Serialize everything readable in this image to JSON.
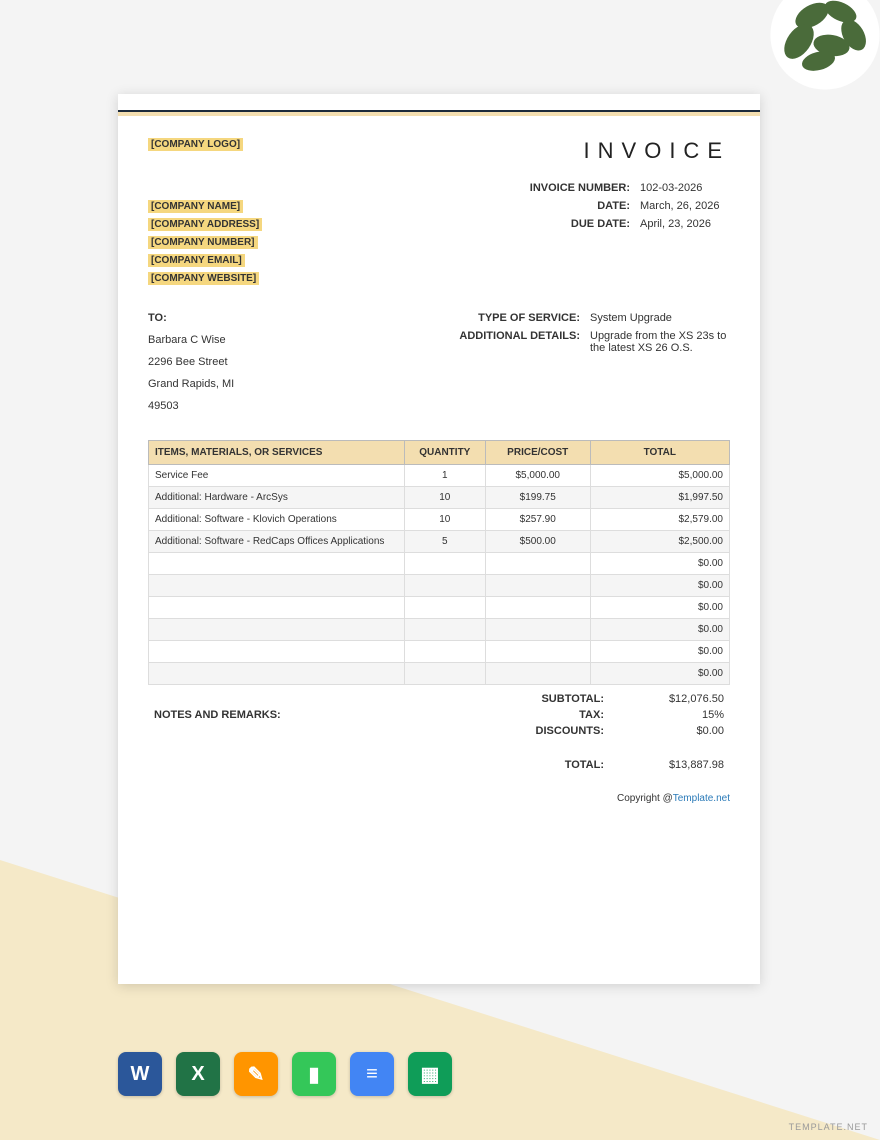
{
  "header": {
    "logo_placeholder": "[COMPANY LOGO]",
    "title": "INVOICE"
  },
  "company": {
    "name": "[COMPANY NAME]",
    "address": "[COMPANY ADDRESS]",
    "number": "[COMPANY NUMBER]",
    "email": "[COMPANY EMAIL]",
    "website": "[COMPANY WEBSITE]"
  },
  "invoice_meta": {
    "number_label": "INVOICE NUMBER:",
    "number_value": "102-03-2026",
    "date_label": "DATE:",
    "date_value": "March, 26, 2026",
    "due_label": "DUE DATE:",
    "due_value": "April, 23, 2026"
  },
  "bill_to": {
    "label": "TO:",
    "name": "Barbara C Wise",
    "street": "2296 Bee Street",
    "city": "Grand Rapids, MI",
    "zip": "49503"
  },
  "service": {
    "type_label": "TYPE OF SERVICE:",
    "type_value": "System Upgrade",
    "details_label": "ADDITIONAL DETAILS:",
    "details_value": "Upgrade from the XS 23s to the latest XS 26 O.S."
  },
  "table": {
    "headers": {
      "items": "ITEMS, MATERIALS, OR SERVICES",
      "qty": "QUANTITY",
      "price": "PRICE/COST",
      "total": "TOTAL"
    },
    "rows": [
      {
        "desc": "Service Fee",
        "qty": "1",
        "price": "$5,000.00",
        "total": "$5,000.00"
      },
      {
        "desc": "Additional: Hardware - ArcSys",
        "qty": "10",
        "price": "$199.75",
        "total": "$1,997.50"
      },
      {
        "desc": "Additional: Software - Klovich Operations",
        "qty": "10",
        "price": "$257.90",
        "total": "$2,579.00"
      },
      {
        "desc": "Additional: Software - RedCaps Offices Applications",
        "qty": "5",
        "price": "$500.00",
        "total": "$2,500.00"
      },
      {
        "desc": "",
        "qty": "",
        "price": "",
        "total": "$0.00"
      },
      {
        "desc": "",
        "qty": "",
        "price": "",
        "total": "$0.00"
      },
      {
        "desc": "",
        "qty": "",
        "price": "",
        "total": "$0.00"
      },
      {
        "desc": "",
        "qty": "",
        "price": "",
        "total": "$0.00"
      },
      {
        "desc": "",
        "qty": "",
        "price": "",
        "total": "$0.00"
      },
      {
        "desc": "",
        "qty": "",
        "price": "",
        "total": "$0.00"
      }
    ]
  },
  "summary": {
    "subtotal_label": "SUBTOTAL:",
    "subtotal_value": "$12,076.50",
    "tax_label": "TAX:",
    "tax_value": "15%",
    "discounts_label": "DISCOUNTS:",
    "discounts_value": "$0.00",
    "total_label": "TOTAL:",
    "total_value": "$13,887.98",
    "notes_label": "NOTES AND REMARKS:"
  },
  "footer": {
    "copyright": "Copyright @",
    "link": "Template.net"
  },
  "apps": [
    {
      "name": "word",
      "color": "#2b579a",
      "glyph": "W"
    },
    {
      "name": "excel",
      "color": "#217346",
      "glyph": "X"
    },
    {
      "name": "pages",
      "color": "#ff9500",
      "glyph": "✎"
    },
    {
      "name": "numbers",
      "color": "#34c759",
      "glyph": "▮"
    },
    {
      "name": "docs",
      "color": "#4285f4",
      "glyph": "≡"
    },
    {
      "name": "sheets",
      "color": "#0f9d58",
      "glyph": "▦"
    }
  ],
  "watermark": "TEMPLATE.NET"
}
